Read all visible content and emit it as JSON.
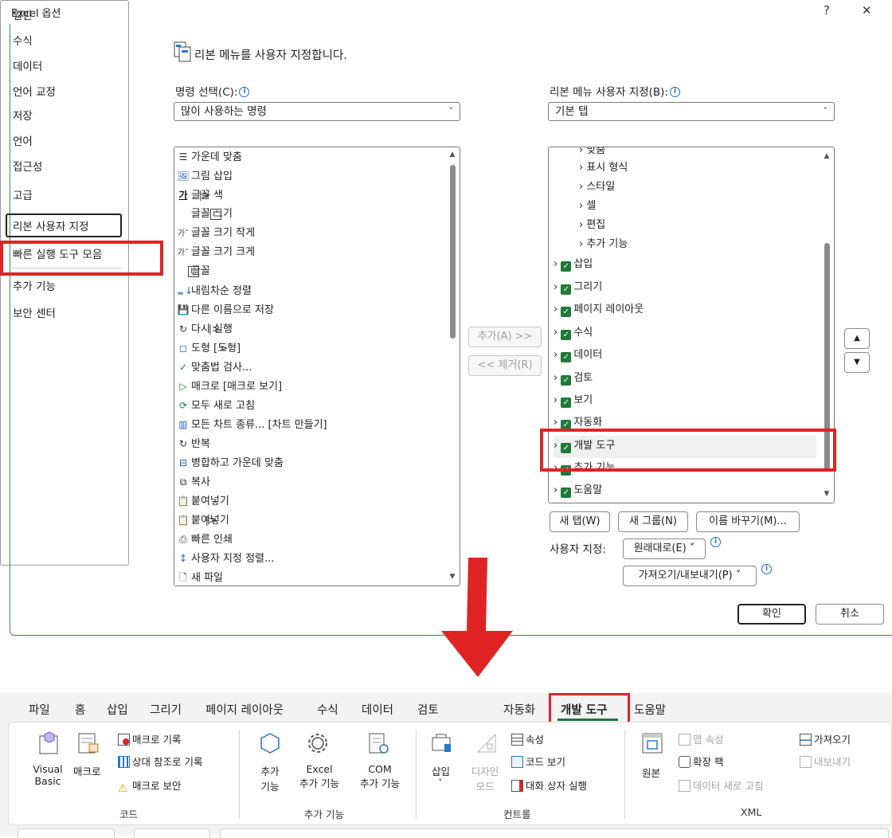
{
  "dialog": {
    "title": "Excel 옵션",
    "help": "?",
    "close": "✕",
    "nav": [
      "일반",
      "수식",
      "데이터",
      "언어 교정",
      "저장",
      "언어",
      "접근성",
      "고급",
      "리본 사용자 지정",
      "빠른 실행 도구 모음",
      "추가 기능",
      "보안 센터"
    ],
    "heading": "리본 메뉴를 사용자 지정합니다.",
    "left_label": "명령 선택(C):",
    "left_select": "많이 사용하는 명령",
    "right_label": "리본 메뉴 사용자 지정(B):",
    "right_select": "기본 탭",
    "commands": [
      {
        "icon": "☰",
        "text": "가운데 맞춤"
      },
      {
        "icon": "🖼",
        "text": "그림 삽입"
      },
      {
        "icon": "가",
        "text": "글꼴 색"
      },
      {
        "icon": "",
        "text": "글꼴 크기"
      },
      {
        "icon": "가ˇ",
        "text": "글꼴 크기 작게"
      },
      {
        "icon": "가ˆ",
        "text": "글꼴 크기 크게"
      },
      {
        "icon": "",
        "text": "글꼴"
      },
      {
        "icon": "ᇂ↓",
        "text": "내림차순 정렬"
      },
      {
        "icon": "💾",
        "text": "다른 이름으로 저장"
      },
      {
        "icon": "↻",
        "text": "다시 실행"
      },
      {
        "icon": "◻",
        "text": "도형 [도형]"
      },
      {
        "icon": "✓",
        "text": "맞춤법 검사..."
      },
      {
        "icon": "▷",
        "text": "매크로 [매크로 보기]"
      },
      {
        "icon": "⟳",
        "text": "모두 새로 고침"
      },
      {
        "icon": "▥",
        "text": "모든 차트 종류... [차트 만들기]"
      },
      {
        "icon": "↻",
        "text": "반복"
      },
      {
        "icon": "⊟",
        "text": "병합하고 가운데 맞춤"
      },
      {
        "icon": "⧉",
        "text": "복사"
      },
      {
        "icon": "📋",
        "text": "붙여넣기"
      },
      {
        "icon": "📋",
        "text": "붙여넣기"
      },
      {
        "icon": "⎙",
        "text": "빠른 인쇄"
      },
      {
        "icon": "↕",
        "text": "사용자 지정 정렬..."
      },
      {
        "icon": "🗋",
        "text": "새 파일"
      }
    ],
    "tabs_tree": [
      {
        "text": "맞춤",
        "level": 1
      },
      {
        "text": "표시 형식",
        "level": 1
      },
      {
        "text": "스타일",
        "level": 1
      },
      {
        "text": "셀",
        "level": 1
      },
      {
        "text": "편집",
        "level": 1
      },
      {
        "text": "추가 기능",
        "level": 1
      },
      {
        "text": "삽입",
        "level": 0
      },
      {
        "text": "그리기",
        "level": 0
      },
      {
        "text": "페이지 레이아웃",
        "level": 0
      },
      {
        "text": "수식",
        "level": 0
      },
      {
        "text": "데이터",
        "level": 0
      },
      {
        "text": "검토",
        "level": 0
      },
      {
        "text": "보기",
        "level": 0
      },
      {
        "text": "자동화",
        "level": 0
      },
      {
        "text": "개발 도구",
        "level": 0
      },
      {
        "text": "추가 기능",
        "level": 0
      },
      {
        "text": "도움말",
        "level": 0
      }
    ],
    "add_button": "추가(A) >>",
    "remove_button": "<< 제거(R)",
    "new_tab": "새 탭(W)",
    "new_group": "새 그룹(N)",
    "rename": "이름 바꾸기(M)...",
    "customize_label": "사용자 지정:",
    "reset": "원래대로(E) ˅",
    "import_export": "가져오기/내보내기(P) ˅",
    "ok": "확인",
    "cancel": "취소"
  },
  "ribbon": {
    "tabs": [
      "파일",
      "홈",
      "삽입",
      "그리기",
      "페이지 레이아웃",
      "수식",
      "데이터",
      "검토",
      "자동화",
      "개발 도구",
      "도움말"
    ],
    "code": {
      "vb_line1": "Visual",
      "vb_line2": "Basic",
      "macro": "매크로",
      "record": "매크로 기록",
      "relative": "상대 참조로 기록",
      "security": "매크로 보안",
      "group": "코드"
    },
    "addins": {
      "addins_line1": "추가",
      "addins_line2": "기능",
      "excel_line1": "Excel",
      "excel_line2": "추가 기능",
      "com_line1": "COM",
      "com_line2": "추가 기능",
      "group": "추가 기능"
    },
    "controls": {
      "insert": "삽입",
      "insert_chev": "˅",
      "design_line1": "디자인",
      "design_line2": "모드",
      "properties": "속성",
      "view_code": "코드 보기",
      "run_dialog": "대화 상자 실행",
      "group": "컨트롤"
    },
    "xml": {
      "source": "원본",
      "map_props": "맵 속성",
      "expansion": "확장 팩",
      "refresh": "데이터 새로 고침",
      "import": "가져오기",
      "export": "내보내기",
      "group": "XML"
    }
  },
  "colors": {
    "highlight": "#e02424",
    "check": "#1f7a3a",
    "active_tab": "#217346"
  }
}
